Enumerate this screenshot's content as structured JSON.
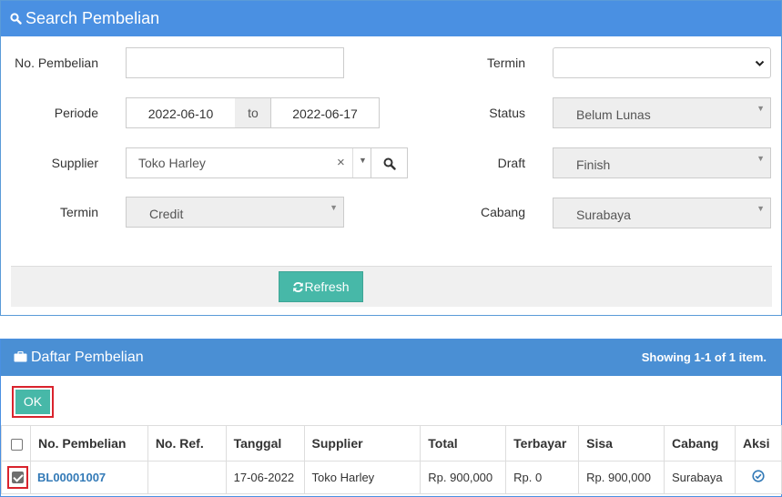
{
  "search": {
    "title": "Search Pembelian",
    "labels": {
      "no_pembelian": "No. Pembelian",
      "periode": "Periode",
      "supplier": "Supplier",
      "termin_left": "Termin",
      "termin_right": "Termin",
      "status": "Status",
      "draft": "Draft",
      "cabang": "Cabang"
    },
    "values": {
      "no_pembelian": "",
      "date_from": "2022-06-10",
      "to_label": "to",
      "date_to": "2022-06-17",
      "supplier": "Toko Harley",
      "termin_left": "Credit",
      "termin_right": "",
      "status": "Belum Lunas",
      "draft": "Finish",
      "cabang": "Surabaya"
    },
    "refresh_label": "Refresh"
  },
  "list": {
    "title": "Daftar Pembelian",
    "showing_prefix": "Showing ",
    "showing_range": "1-1",
    "showing_of": " of ",
    "showing_total": "1",
    "showing_suffix": " item.",
    "ok_label": "OK",
    "columns": [
      "No. Pembelian",
      "No. Ref.",
      "Tanggal",
      "Supplier",
      "Total",
      "Terbayar",
      "Sisa",
      "Cabang",
      "Aksi"
    ],
    "rows": [
      {
        "no_pembelian": "BL00001007",
        "no_ref": "",
        "tanggal": "17-06-2022",
        "supplier": "Toko Harley",
        "total": "Rp. 900,000",
        "terbayar": "Rp. 0",
        "sisa": "Rp. 900,000",
        "cabang": "Surabaya",
        "checked": true
      }
    ]
  },
  "colors": {
    "header_blue": "#4a90e2",
    "accent_teal": "#47b8a8",
    "highlight_red": "#d9232d",
    "link_blue": "#337ab7"
  }
}
